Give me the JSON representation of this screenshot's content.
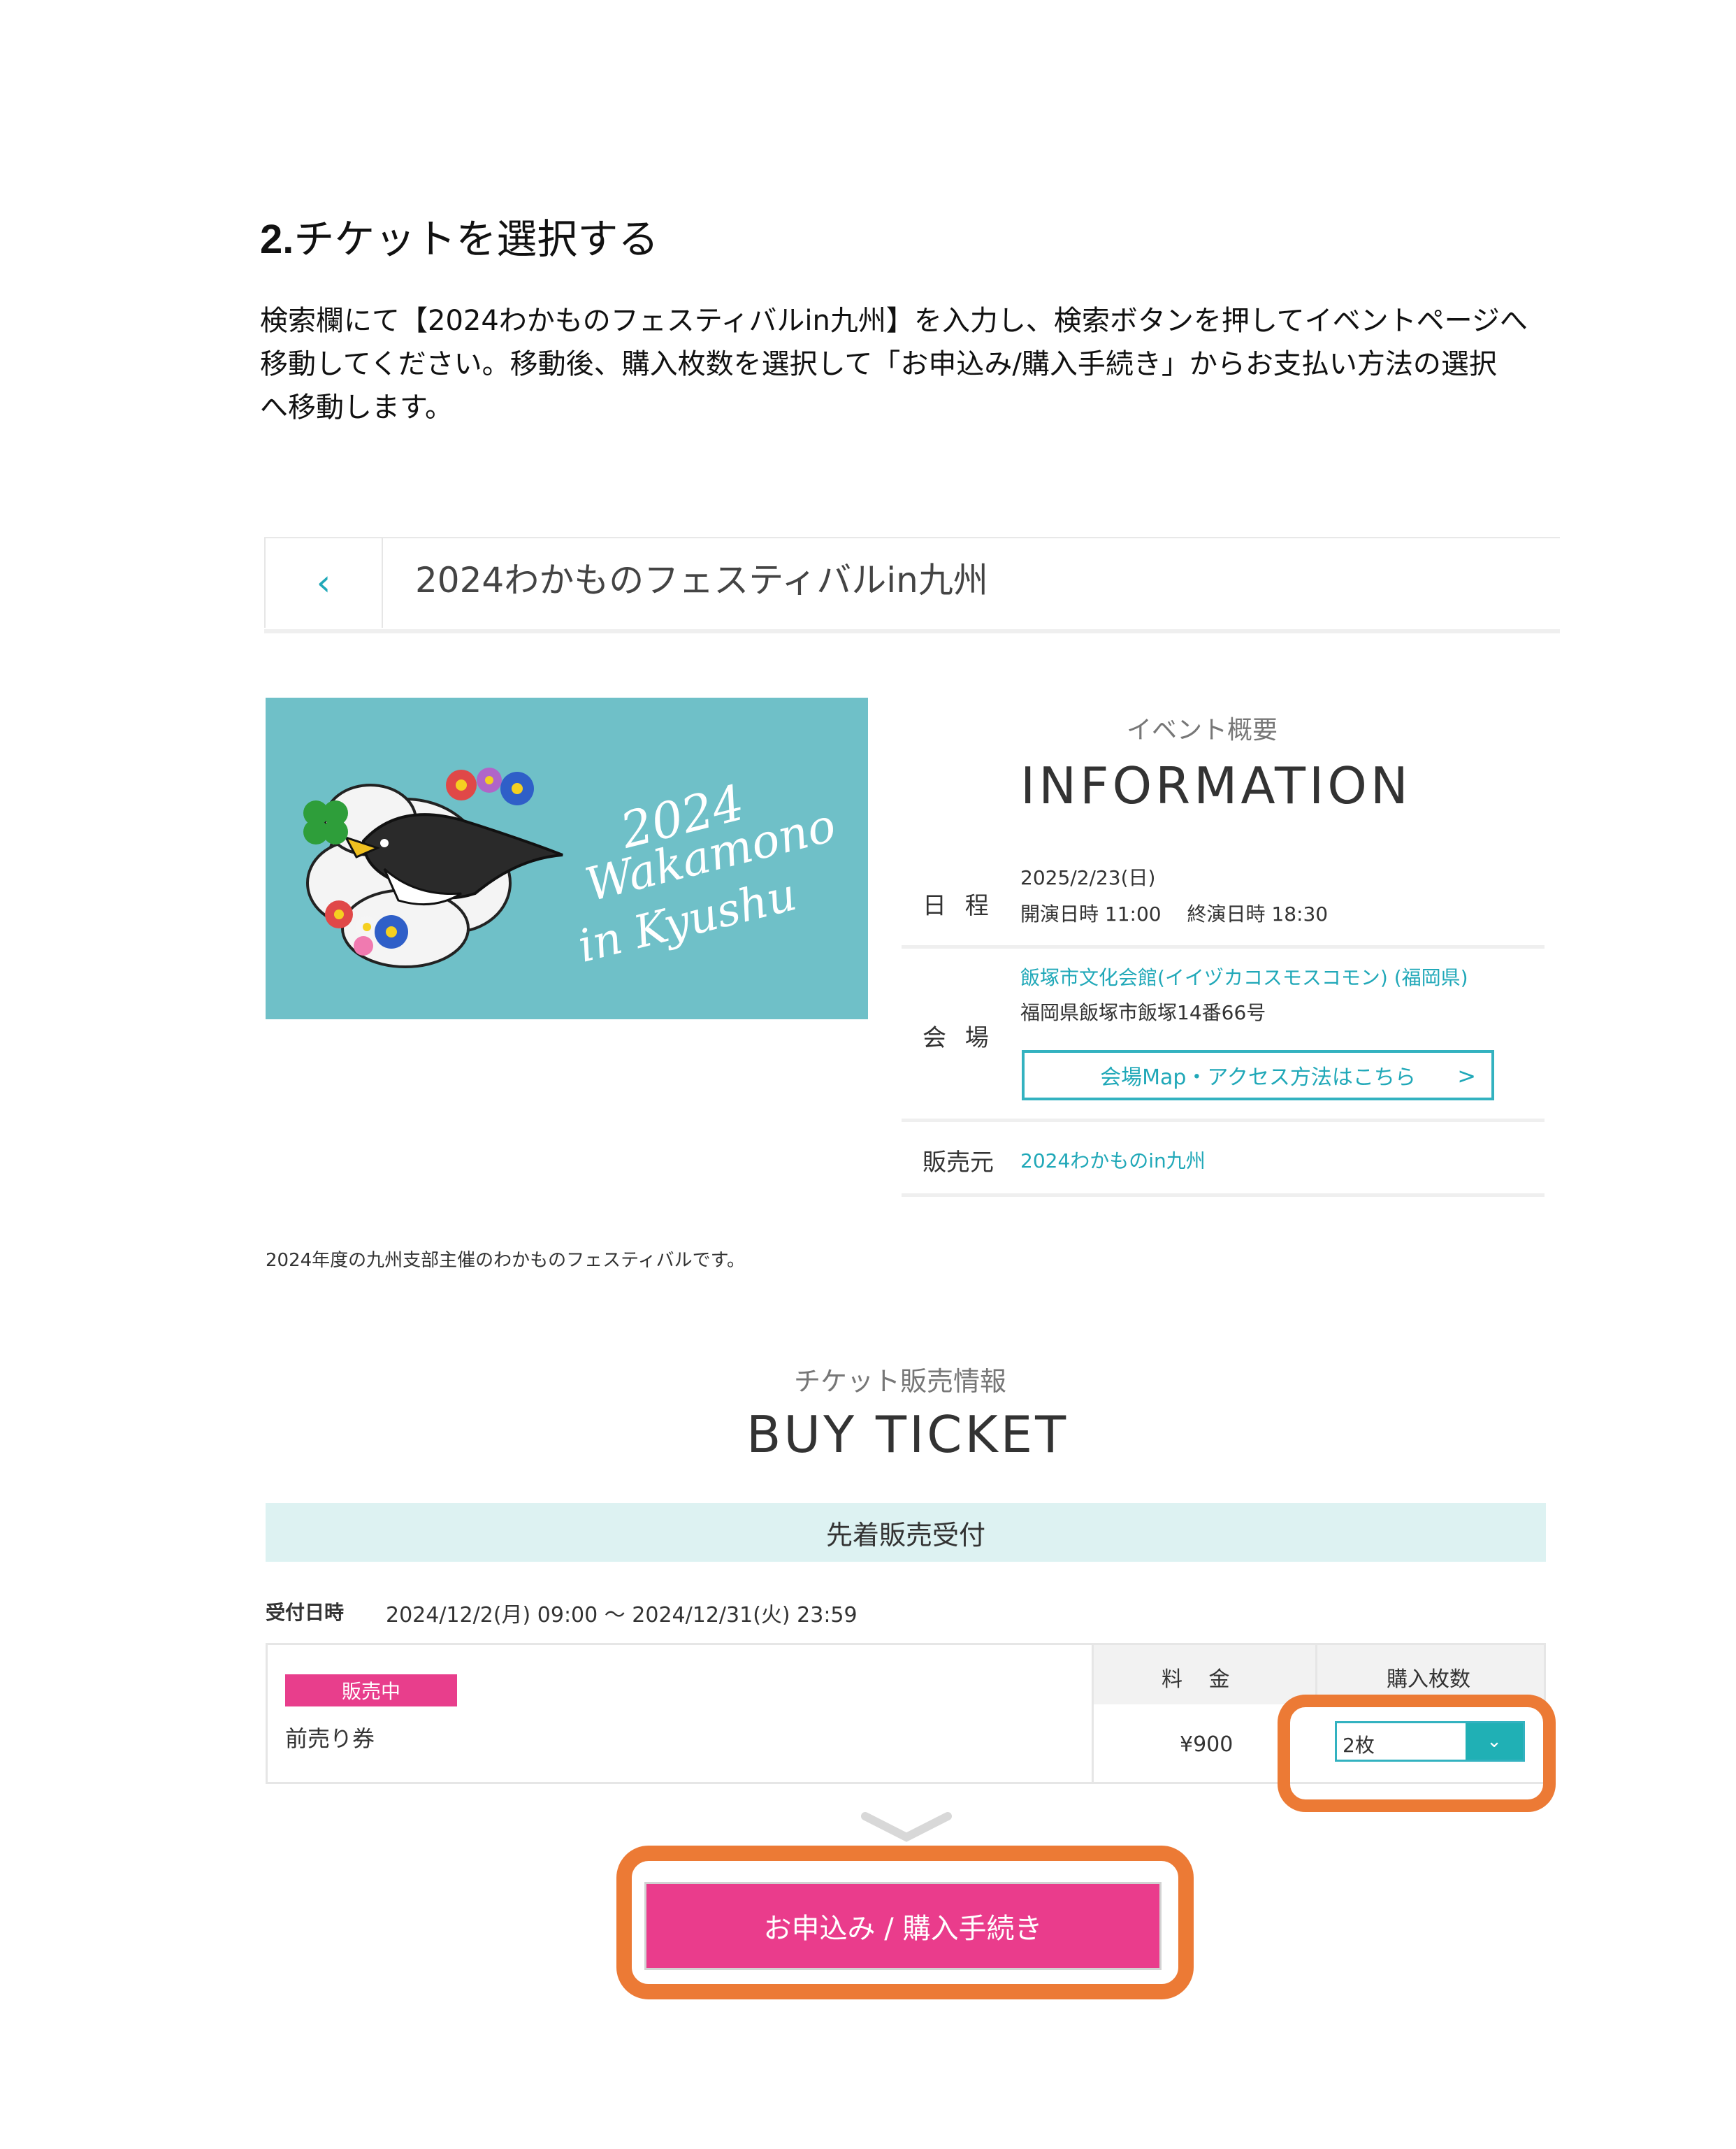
{
  "doc": {
    "step_number": "2.",
    "step_title": "チケットを選択する",
    "instruction_lines": [
      "検索欄にて【2024わかものフェスティバルin九州】を入力し、検索ボタンを押してイベントページへ",
      "移動してください。移動後、購入枚数を選択して「お申込み/購入手続き」からお支払い方法の選択",
      "へ移動します。"
    ]
  },
  "event": {
    "title": "2024わかものフェスティバルin九州",
    "banner_text": [
      "2024",
      "Wakamono",
      "in Kyushu"
    ],
    "description": "2024年度の九州支部主催のわかものフェスティバルです。"
  },
  "info": {
    "kicker": "イベント概要",
    "heading": "INFORMATION",
    "schedule_label": "日 程",
    "schedule_date": "2025/2/23(日)",
    "schedule_times": "開演日時 11:00　 終演日時 18:30",
    "venue_label": "会 場",
    "venue_name": "飯塚市文化会館(イイヅカコスモスコモン) (福岡県)",
    "venue_address": "福岡県飯塚市飯塚14番66号",
    "access_button": "会場Map・アクセス方法はこちら",
    "access_chevron": ">",
    "seller_label": "販売元",
    "seller_name": "2024わかものin九州"
  },
  "tickets": {
    "kicker": "チケット販売情報",
    "heading": "BUY TICKET",
    "sale_type": "先着販売受付",
    "period_label": "受付日時",
    "period_value": "2024/12/2(月) 09:00 ～ 2024/12/31(火) 23:59",
    "price_header": "料 金",
    "qty_header": "購入枚数",
    "status_badge": "販売中",
    "ticket_name": "前売り券",
    "ticket_price": "¥900",
    "qty_selected": "2枚"
  },
  "submit_button": "お申込み / 購入手続き",
  "colors": {
    "accent_teal": "#20a8b8",
    "banner_teal": "#6fc0c8",
    "pink": "#ea3c8c",
    "highlight_orange": "#ec7a35"
  }
}
